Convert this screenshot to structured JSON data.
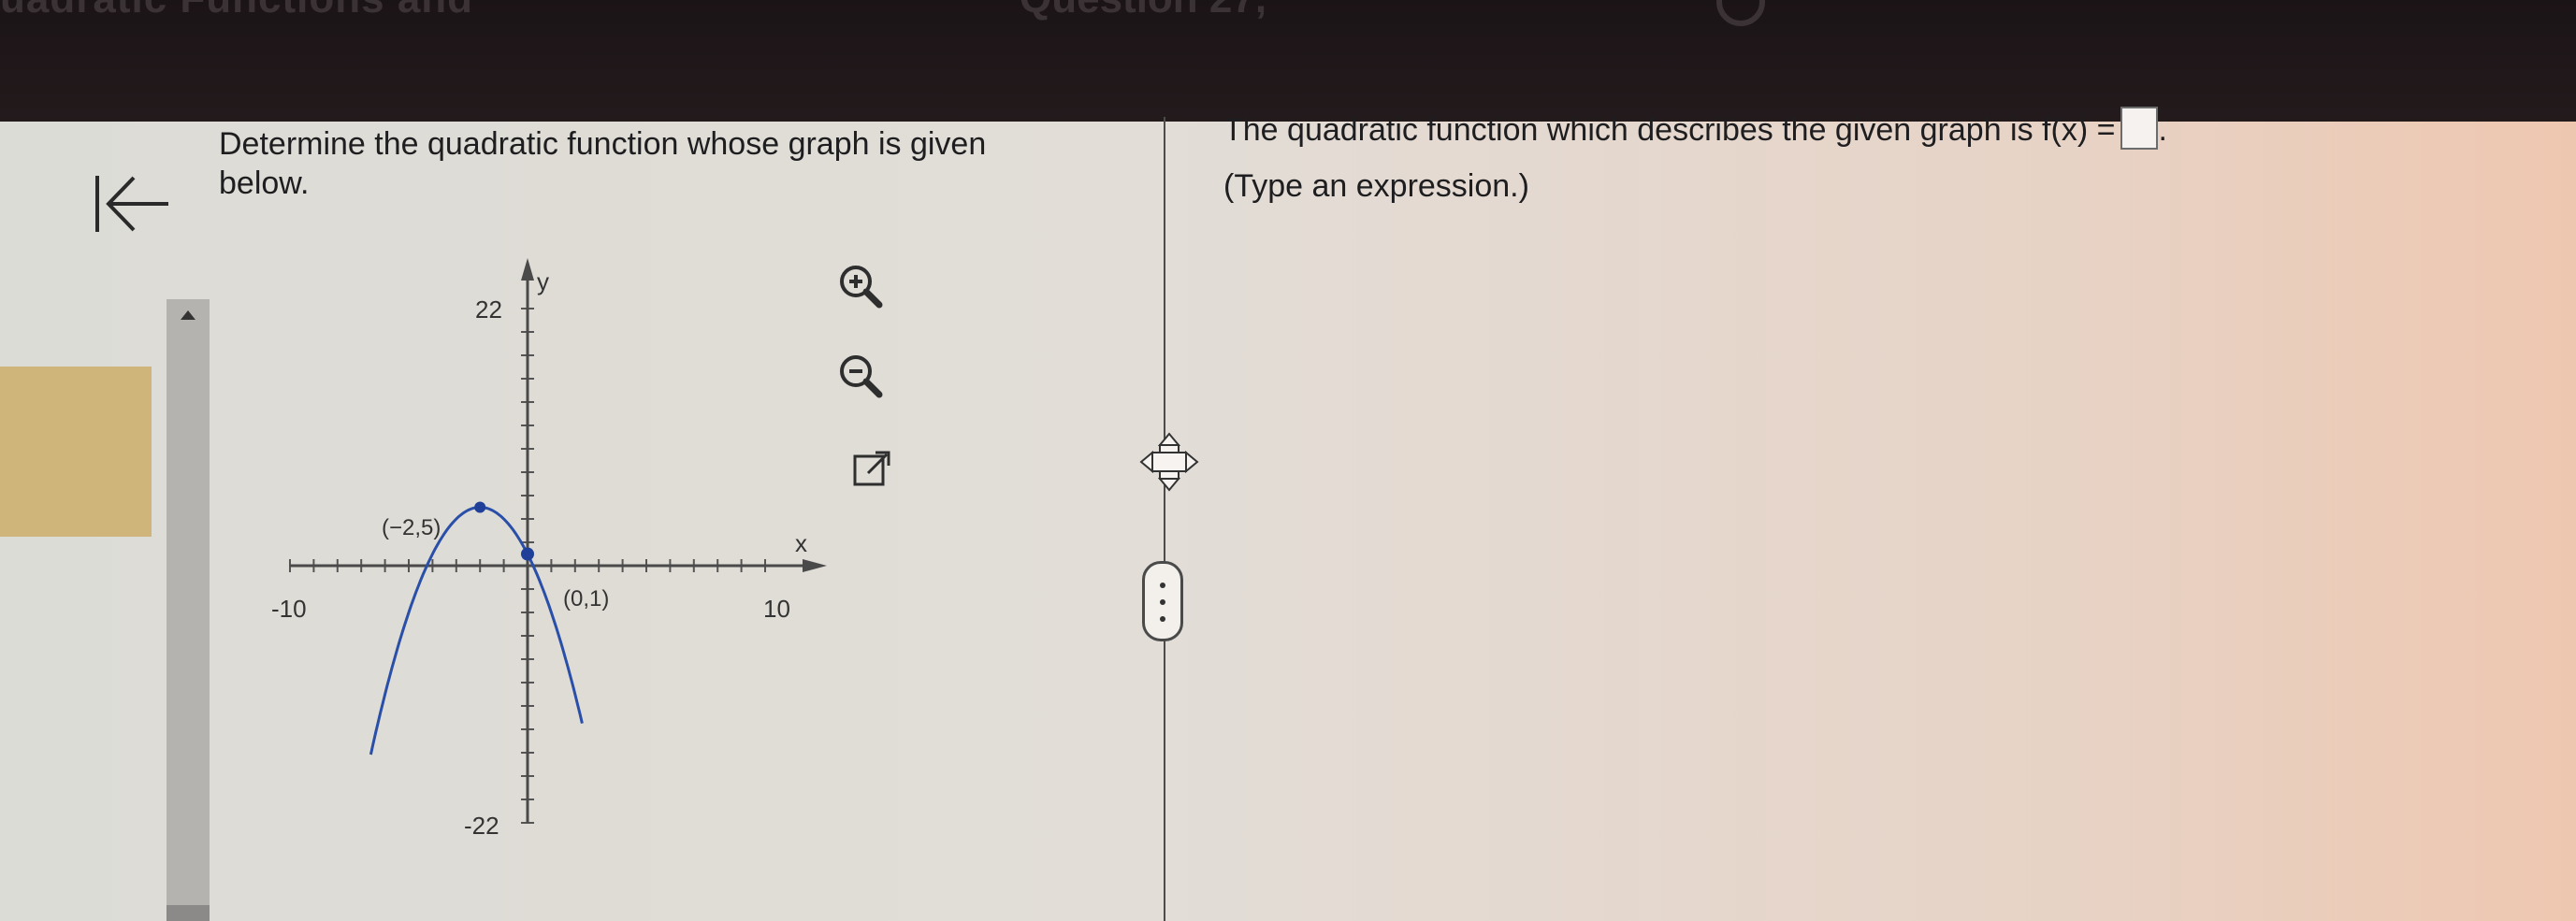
{
  "header": {
    "title": "uadratic Functions and",
    "question_label": "Question 27,"
  },
  "question": {
    "text_line1": "Determine the quadratic function whose graph is given",
    "text_line2": "below."
  },
  "answer": {
    "prompt": "The quadratic function which describes the given graph is f(x) =",
    "after_box": ".",
    "hint": "(Type an expression.)"
  },
  "graph_tools": [
    "zoom-in",
    "zoom-out",
    "open-in-new-window"
  ],
  "chart_data": {
    "type": "line",
    "title": "",
    "xlabel": "x",
    "ylabel": "y",
    "xlim": [
      -10,
      10
    ],
    "ylim": [
      -22,
      22
    ],
    "tick_labels": {
      "x_min": "-10",
      "x_max": "10",
      "y_max": "22",
      "y_min": "-22"
    },
    "function": "y = -(x + 2)^2 + 5",
    "series": [
      {
        "x": [
          -6.6,
          -5,
          -4,
          -3,
          -2,
          -1,
          0,
          1,
          2.3
        ],
        "y": [
          -16.2,
          -4,
          1,
          4,
          5,
          4,
          1,
          -4,
          -13.5
        ]
      }
    ],
    "points": [
      {
        "label": "(−2,5)",
        "x": -2,
        "y": 5
      },
      {
        "label": "(0,1)",
        "x": 0,
        "y": 1
      }
    ],
    "colors": {
      "curve": "#2a4fa8",
      "point": "#1f3f99"
    }
  }
}
